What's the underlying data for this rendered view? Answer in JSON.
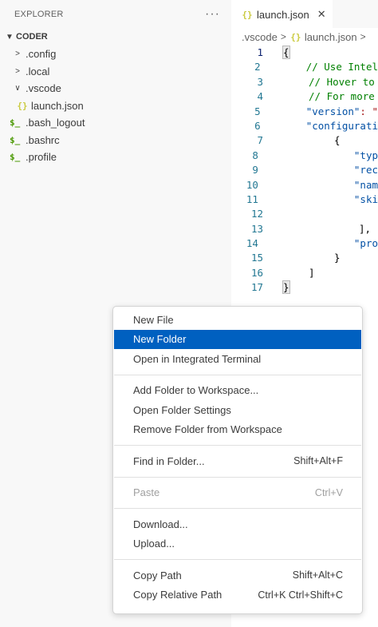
{
  "sidebar": {
    "title": "EXPLORER",
    "more_actions": "···",
    "section_title": "CODER",
    "items": [
      {
        "label": ".config",
        "kind": "folder-collapsed"
      },
      {
        "label": ".local",
        "kind": "folder-collapsed"
      },
      {
        "label": ".vscode",
        "kind": "folder-expanded"
      },
      {
        "label": "launch.json",
        "kind": "json-file"
      },
      {
        "label": ".bash_logout",
        "kind": "shell-file"
      },
      {
        "label": ".bashrc",
        "kind": "shell-file"
      },
      {
        "label": ".profile",
        "kind": "shell-file"
      }
    ]
  },
  "editor": {
    "tab": {
      "label": "launch.json",
      "close": "✕"
    },
    "breadcrumb": [
      ".vscode",
      "launch.json"
    ],
    "line_numbers": [
      "1",
      "2",
      "3",
      "4",
      "5",
      "6",
      "7",
      "8",
      "9",
      "10",
      "11",
      "12",
      "13",
      "14",
      "15",
      "16",
      "17"
    ],
    "lines": {
      "l1": "{",
      "l2": "// Use Intel",
      "l3": "// Hover to",
      "l4": "// For more",
      "l5_key": "\"version\"",
      "l5_rest": ": \"",
      "l6_key": "\"configurati",
      "l7": "{",
      "l8": "\"typ",
      "l9": "\"rec",
      "l10": "\"nam",
      "l11": "\"ski",
      "l12": "",
      "l13": "],",
      "l14": "\"pro",
      "l15": "}",
      "l16": "]",
      "l17": "}"
    }
  },
  "context_menu": {
    "groups": [
      [
        {
          "label": "New File",
          "shortcut": ""
        },
        {
          "label": "New Folder",
          "shortcut": "",
          "highlighted": true
        },
        {
          "label": "Open in Integrated Terminal",
          "shortcut": ""
        }
      ],
      [
        {
          "label": "Add Folder to Workspace...",
          "shortcut": ""
        },
        {
          "label": "Open Folder Settings",
          "shortcut": ""
        },
        {
          "label": "Remove Folder from Workspace",
          "shortcut": ""
        }
      ],
      [
        {
          "label": "Find in Folder...",
          "shortcut": "Shift+Alt+F"
        }
      ],
      [
        {
          "label": "Paste",
          "shortcut": "Ctrl+V",
          "disabled": true
        }
      ],
      [
        {
          "label": "Download...",
          "shortcut": ""
        },
        {
          "label": "Upload...",
          "shortcut": ""
        }
      ],
      [
        {
          "label": "Copy Path",
          "shortcut": "Shift+Alt+C"
        },
        {
          "label": "Copy Relative Path",
          "shortcut": "Ctrl+K Ctrl+Shift+C"
        }
      ]
    ]
  },
  "colors": {
    "menu_highlight": "#0060c0",
    "line_number": "#237893",
    "comment": "#008000",
    "json_key": "#0451a5",
    "json_icon": "#cbcb41",
    "shell_icon": "#4d9a06"
  },
  "icons": {
    "json": "{}",
    "shell": "$_",
    "chevron_right": "›",
    "chevron_down": "⌄"
  }
}
